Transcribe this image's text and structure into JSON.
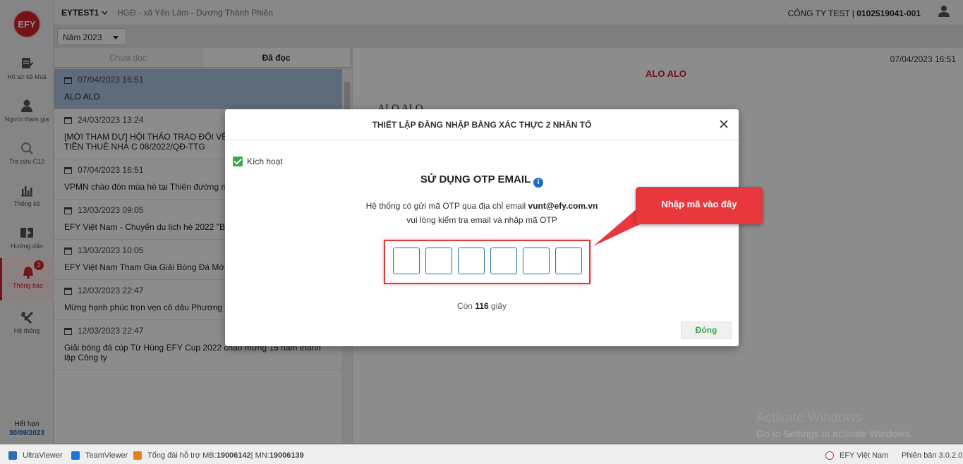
{
  "sidebar": {
    "logo": "EFY",
    "items": [
      {
        "label": "Hồ sơ kê khai",
        "icon": "document-edit-icon"
      },
      {
        "label": "Người tham gia",
        "icon": "person-icon"
      },
      {
        "label": "Tra cứu C12",
        "icon": "search-icon"
      },
      {
        "label": "Thống kê",
        "icon": "bar-chart-icon"
      },
      {
        "label": "Hướng dẫn",
        "icon": "book-icon"
      },
      {
        "label": "Thông báo",
        "icon": "bell-icon",
        "badge": "2",
        "active": true
      },
      {
        "label": "Hệ thống",
        "icon": "tools-icon"
      }
    ],
    "expiry_label": "Hết hạn",
    "expiry_date": "30/09/2023"
  },
  "header": {
    "org_code": "EYTEST1",
    "org_name": "HGĐ - xã Yên Lâm - Dương Thành Phiên",
    "company_name": "CÔNG TY TEST | ",
    "company_tax": "0102519041-001"
  },
  "filter": {
    "year": "Năm 2023"
  },
  "tabs": [
    {
      "label": "Chưa đọc",
      "selected": false
    },
    {
      "label": "Đã đọc",
      "selected": true
    }
  ],
  "messages": [
    {
      "time": "07/04/2023 16:51",
      "title": "ALO ALO"
    },
    {
      "time": "24/03/2023 13:24",
      "title": "[MỜI THAM DỰ] HỘI THẢO TRAO ĐỔI VỀ CHÍNH SÁCH HỖ TRỢ TIỀN THUÊ NHÀ C 08/2022/QĐ-TTG"
    },
    {
      "time": "07/04/2023 16:51",
      "title": "VPMN chào đón mùa hè tại Thiên đường n Thiết"
    },
    {
      "time": "13/03/2023 09:05",
      "title": "EFY Việt Nam - Chuyến du lịch hè 2022 \"B đam mê.\""
    },
    {
      "time": "13/03/2023 10:05",
      "title": "EFY Việt Nam Tham Gia Giải Bóng Đá Mở"
    },
    {
      "time": "12/03/2023 22:47",
      "title": "Mừng hạnh phúc trọn vẹn cô dâu Phương Tú – chú rể Thanh Nghị"
    },
    {
      "time": "12/03/2023 22:47",
      "title": "Giải bóng đá cúp Từ Hùng EFY Cup 2022 chào mừng 15 năm thành lập Công ty"
    }
  ],
  "detail": {
    "date": "07/04/2023 16:51",
    "title": "ALO ALO",
    "body": "ALO ALO"
  },
  "modal": {
    "title": "THIẾT LẬP ĐĂNG NHẬP BẰNG XÁC THỰC 2 NHÂN TỐ",
    "activate_label": "Kích hoạt",
    "activate_checked": true,
    "otp_heading": "SỬ DỤNG OTP EMAIL",
    "line1_prefix": "Hệ thống có gửi mã OTP qua địa chỉ email ",
    "email": "vunt@efy.com.vn",
    "line2": "vui lòng kiểm tra email và nhập mã OTP",
    "otp_digits": [
      "",
      "",
      "",
      "",
      "",
      ""
    ],
    "countdown_prefix": "Còn ",
    "countdown_value": "116",
    "countdown_suffix": " giây",
    "close_button": "Đóng"
  },
  "callout": {
    "text": "Nhập mã vào đây",
    "color": "#e8383d"
  },
  "footer": {
    "ultraviewer": "UltraViewer",
    "teamviewer": "TeamViewer",
    "hotline_prefix": "Tổng đài hỗ trợ MB: ",
    "hotline_mb": "19006142",
    "hotline_sep": " | MN: ",
    "hotline_mn": "19006139",
    "brand": "EFY Việt Nam",
    "version": "Phiên bản 3.0.2.0"
  },
  "watermark": {
    "title": "Activate Windows",
    "subtitle": "Go to Settings to activate Windows."
  },
  "colors": {
    "brand_red": "#d1232a",
    "accent_green": "#3ea64a",
    "link_blue": "#1c5fa8"
  }
}
